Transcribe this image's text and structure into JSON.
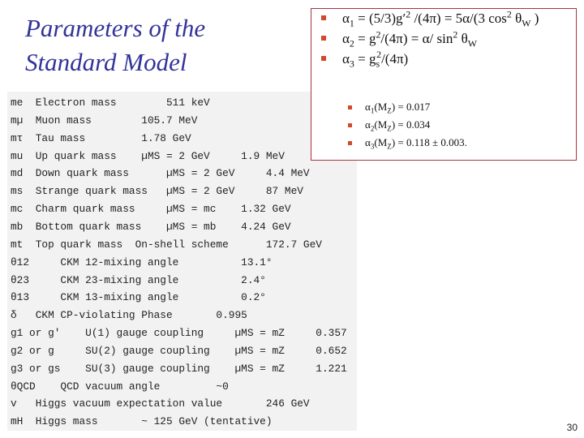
{
  "slide": {
    "title_line1": "Parameters of the",
    "title_line2": "Standard Model",
    "page_number": "30"
  },
  "colors": {
    "title": "#333399",
    "box_border": "#a8343c",
    "bullet": "#d04a2a",
    "table_background": "#f2f2f2"
  },
  "formulas": [
    {
      "lhs": "α",
      "lhs_sub": "1",
      "rhs_parts": [
        " = (5/3)g′",
        "2",
        " /(4π) = 5α/(3 cos",
        "2",
        " θ",
        "W",
        " )"
      ]
    },
    {
      "lhs": "α",
      "lhs_sub": "2",
      "rhs_parts": [
        " = g",
        "2",
        "/(4π) = α/ sin",
        "2",
        " θ",
        "W"
      ]
    },
    {
      "lhs": "α",
      "lhs_sub": "3",
      "rhs_parts": [
        " = g",
        "s",
        "2",
        "/(4π)"
      ]
    }
  ],
  "coupling_values": [
    {
      "alpha": "α",
      "sub": "1",
      "scale": "(M",
      "scale_sub": "Z",
      "value": ") = 0.017"
    },
    {
      "alpha": "α",
      "sub": "2",
      "scale": "(M",
      "scale_sub": "Z",
      "value": ") = 0.034"
    },
    {
      "alpha": "α",
      "sub": "3",
      "scale": "(M",
      "scale_sub": "Z",
      "value": ") = 0.118 ± 0.003."
    }
  ],
  "parameters_table": {
    "rows": [
      {
        "symbol": "me",
        "text": "me  Electron mass        511 keV"
      },
      {
        "symbol": "mµ",
        "text": "mµ  Muon mass        105.7 MeV"
      },
      {
        "symbol": "mτ",
        "text": "mτ  Tau mass         1.78 GeV"
      },
      {
        "symbol": "mu",
        "text": "mu  Up quark mass    µMS = 2 GeV     1.9 MeV"
      },
      {
        "symbol": "md",
        "text": "md  Down quark mass      µMS = 2 GeV     4.4 MeV"
      },
      {
        "symbol": "ms",
        "text": "ms  Strange quark mass   µMS = 2 GeV     87 MeV"
      },
      {
        "symbol": "mc",
        "text": "mc  Charm quark mass     µMS = mc    1.32 GeV"
      },
      {
        "symbol": "mb",
        "text": "mb  Bottom quark mass    µMS = mb    4.24 GeV"
      },
      {
        "symbol": "mt",
        "text": "mt  Top quark mass  On-shell scheme      172.7 GeV"
      },
      {
        "symbol": "θ12",
        "text": "θ12     CKM 12-mixing angle          13.1°"
      },
      {
        "symbol": "θ23",
        "text": "θ23     CKM 23-mixing angle          2.4°"
      },
      {
        "symbol": "θ13",
        "text": "θ13     CKM 13-mixing angle          0.2°"
      },
      {
        "symbol": "δ",
        "text": "δ   CKM CP-violating Phase       0.995"
      },
      {
        "symbol": "g1 or g'",
        "text": "g1 or g'    U(1) gauge coupling     µMS = mZ     0.357"
      },
      {
        "symbol": "g2 or g",
        "text": "g2 or g     SU(2) gauge coupling    µMS = mZ     0.652"
      },
      {
        "symbol": "g3 or gs",
        "text": "g3 or gs    SU(3) gauge coupling    µMS = mZ     1.221"
      },
      {
        "symbol": "θQCD",
        "text": "θQCD    QCD vacuum angle         ~0"
      },
      {
        "symbol": "v",
        "text": "v   Higgs vacuum expectation value       246 GeV"
      },
      {
        "symbol": "mH",
        "text": "mH  Higgs mass       ~ 125 GeV (tentative)"
      }
    ]
  }
}
